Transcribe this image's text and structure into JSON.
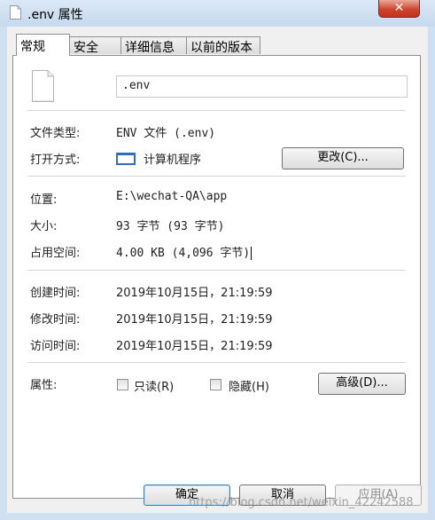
{
  "window": {
    "title": ".env 属性",
    "close_label": "✕"
  },
  "tabs": [
    {
      "label": "常规"
    },
    {
      "label": "安全"
    },
    {
      "label": "详细信息"
    },
    {
      "label": "以前的版本"
    }
  ],
  "file_name": ".env",
  "file_type": {
    "label": "文件类型:",
    "value": "ENV 文件 (.env)"
  },
  "open_with": {
    "label": "打开方式:",
    "value": "计算机程序",
    "icon": "app-window-icon",
    "change_button": "更改(C)..."
  },
  "location": {
    "label": "位置:",
    "value": "E:\\wechat-QA\\app"
  },
  "size": {
    "label": "大小:",
    "value": "93 字节 (93 字节)"
  },
  "size_on_disk": {
    "label": "占用空间:",
    "value": "4.00 KB (4,096 字节)"
  },
  "created": {
    "label": "创建时间:",
    "value": "2019年10月15日，21:19:59"
  },
  "modified": {
    "label": "修改时间:",
    "value": "2019年10月15日，21:19:59"
  },
  "accessed": {
    "label": "访问时间:",
    "value": "2019年10月15日，21:19:59"
  },
  "attributes": {
    "label": "属性:",
    "readonly_label": "只读(R)",
    "readonly_checked": false,
    "hidden_label": "隐藏(H)",
    "hidden_checked": false,
    "advanced_button": "高级(D)..."
  },
  "buttons": {
    "ok": "确定",
    "cancel": "取消",
    "apply": "应用(A)"
  },
  "watermark": "https://blog.csdn.net/weixin_42242588"
}
